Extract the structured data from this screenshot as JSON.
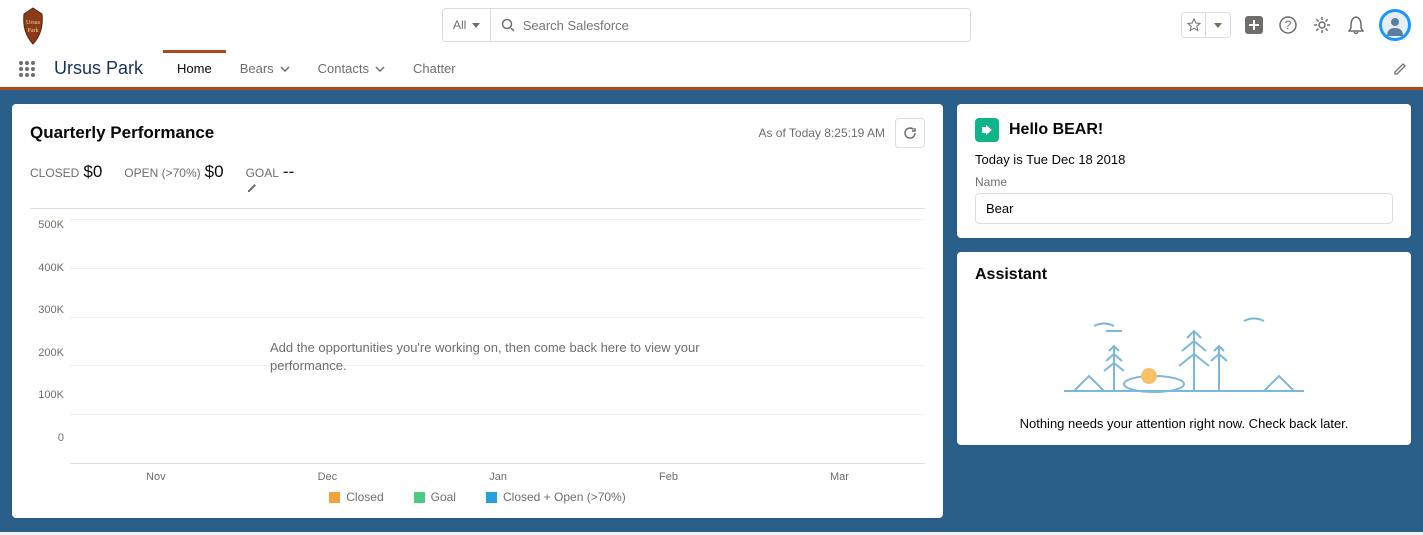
{
  "header": {
    "search_scope": "All",
    "search_placeholder": "Search Salesforce"
  },
  "nav": {
    "app_name": "Ursus Park",
    "tabs": [
      {
        "label": "Home",
        "active": true,
        "menu": false
      },
      {
        "label": "Bears",
        "active": false,
        "menu": true
      },
      {
        "label": "Contacts",
        "active": false,
        "menu": true
      },
      {
        "label": "Chatter",
        "active": false,
        "menu": false
      }
    ]
  },
  "quarterly": {
    "title": "Quarterly Performance",
    "asof": "As of Today 8:25:19 AM",
    "metrics": {
      "closed_label": "CLOSED",
      "closed_value": "$0",
      "open_label": "OPEN (>70%)",
      "open_value": "$0",
      "goal_label": "GOAL",
      "goal_value": "--"
    },
    "empty_message": "Add the opportunities you're working on, then come back here to view your performance."
  },
  "chart_data": {
    "type": "area",
    "title": "Quarterly Performance",
    "x": [
      "Nov",
      "Dec",
      "Jan",
      "Feb",
      "Mar"
    ],
    "y_ticks": [
      "500K",
      "400K",
      "300K",
      "200K",
      "100K",
      "0"
    ],
    "ylim": [
      0,
      500000
    ],
    "series": [
      {
        "name": "Closed",
        "color": "#f2a340",
        "values": []
      },
      {
        "name": "Goal",
        "color": "#4bca81",
        "values": []
      },
      {
        "name": "Closed + Open (>70%)",
        "color": "#26a0da",
        "values": []
      }
    ]
  },
  "hello": {
    "title": "Hello BEAR!",
    "date": "Today is Tue Dec 18 2018",
    "name_label": "Name",
    "name_value": "Bear"
  },
  "assistant": {
    "title": "Assistant",
    "message": "Nothing needs your attention right now. Check back later."
  }
}
